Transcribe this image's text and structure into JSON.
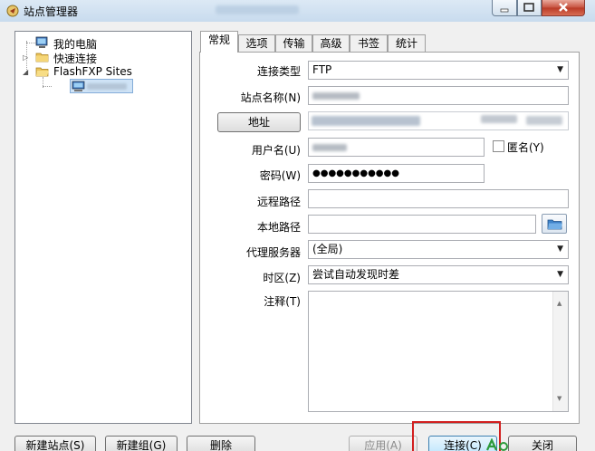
{
  "window": {
    "title": "站点管理器"
  },
  "tree": {
    "items": [
      {
        "label": "我的电脑",
        "icon": "computer-icon"
      },
      {
        "label": "快速连接",
        "icon": "folder-icon"
      },
      {
        "label": "FlashFXP Sites",
        "icon": "folder-icon"
      }
    ]
  },
  "tabs": [
    "常规",
    "选项",
    "传输",
    "高级",
    "书签",
    "统计"
  ],
  "form": {
    "connection_type_label": "连接类型",
    "connection_type_value": "FTP",
    "site_name_label": "站点名称(N)",
    "address_button": "地址",
    "username_label": "用户名(U)",
    "anonymous_label": "匿名(Y)",
    "password_label": "密码(W)",
    "password_value": "●●●●●●●●●●●",
    "remote_path_label": "远程路径",
    "local_path_label": "本地路径",
    "proxy_label": "代理服务器",
    "proxy_value": "(全局)",
    "timezone_label": "时区(Z)",
    "timezone_value": "尝试自动发现时差",
    "notes_label": "注释(T)"
  },
  "buttons": {
    "new_site": "新建站点(S)",
    "new_group": "新建组(G)",
    "delete": "删除",
    "apply": "应用(A)",
    "connect": "连接(C)",
    "close": "关闭"
  },
  "colors": {
    "highlight_box": "#d21f1f",
    "selection": "#cfe3f6"
  }
}
